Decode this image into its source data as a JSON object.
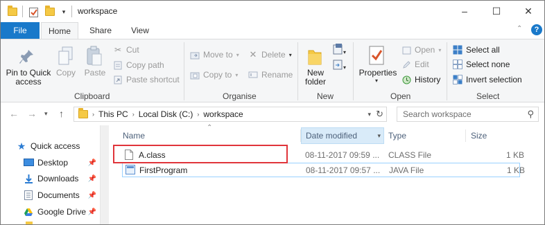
{
  "window": {
    "title": "workspace",
    "minimize": "–",
    "maximize": "☐",
    "close": "✕"
  },
  "tabs": {
    "file": "File",
    "home": "Home",
    "share": "Share",
    "view": "View"
  },
  "ribbon": {
    "clipboard": {
      "pin_label": "Pin to Quick\naccess",
      "copy": "Copy",
      "paste": "Paste",
      "cut": "Cut",
      "copy_path": "Copy path",
      "paste_shortcut": "Paste shortcut",
      "group": "Clipboard"
    },
    "organise": {
      "move_to": "Move to",
      "copy_to": "Copy to",
      "delete": "Delete",
      "rename": "Rename",
      "group": "Organise"
    },
    "new": {
      "new_folder": "New\nfolder",
      "group": "New"
    },
    "open": {
      "properties": "Properties",
      "open": "Open",
      "edit": "Edit",
      "history": "History",
      "group": "Open"
    },
    "select": {
      "select_all": "Select all",
      "select_none": "Select none",
      "invert": "Invert selection",
      "group": "Select"
    }
  },
  "address": {
    "crumbs": [
      "This PC",
      "Local Disk (C:)",
      "workspace"
    ],
    "search_placeholder": "Search workspace"
  },
  "navpane": {
    "items": [
      {
        "label": "Quick access",
        "icon": "star-icon"
      },
      {
        "label": "Desktop",
        "icon": "desktop-icon"
      },
      {
        "label": "Downloads",
        "icon": "download-icon"
      },
      {
        "label": "Documents",
        "icon": "documents-icon"
      },
      {
        "label": "Google Drive",
        "icon": "google-drive-icon"
      }
    ]
  },
  "filelist": {
    "columns": [
      "Name",
      "Date modified",
      "Type",
      "Size"
    ],
    "rows": [
      {
        "name": "A.class",
        "date": "08-11-2017 09:59 ...",
        "type": "CLASS File",
        "size": "1 KB"
      },
      {
        "name": "FirstProgram",
        "date": "08-11-2017 09:57 ...",
        "type": "JAVA File",
        "size": "1 KB"
      }
    ]
  },
  "colors": {
    "accent": "#1979ca",
    "highlight_box": "#e0343a",
    "sorted_column": "#d9ebf9"
  }
}
